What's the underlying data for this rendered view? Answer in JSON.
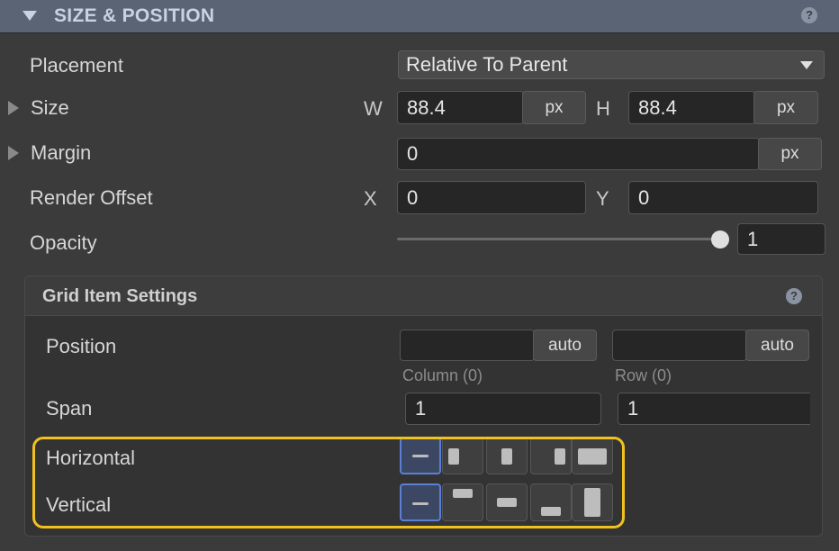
{
  "header": {
    "title": "SIZE & POSITION",
    "help": "?"
  },
  "placement": {
    "label": "Placement",
    "value": "Relative To Parent"
  },
  "size": {
    "label": "Size",
    "w_label": "W",
    "w_value": "88.4",
    "w_unit": "px",
    "h_label": "H",
    "h_value": "88.4",
    "h_unit": "px"
  },
  "margin": {
    "label": "Margin",
    "value": "0",
    "unit": "px"
  },
  "render_offset": {
    "label": "Render Offset",
    "x_label": "X",
    "x_value": "0",
    "y_label": "Y",
    "y_value": "0"
  },
  "opacity": {
    "label": "Opacity",
    "value": "1",
    "level": 1.0
  },
  "grid_item": {
    "title": "Grid Item Settings",
    "help": "?",
    "position": {
      "label": "Position",
      "column_value": "",
      "column_unit": "auto",
      "row_value": "",
      "row_unit": "auto",
      "column_caption": "Column (0)",
      "row_caption": "Row (0)"
    },
    "span": {
      "label": "Span",
      "column_value": "1",
      "row_value": "1"
    },
    "horizontal": {
      "label": "Horizontal",
      "options": [
        "none-icon",
        "align-start-icon",
        "align-center-icon",
        "align-end-icon",
        "stretch-icon"
      ],
      "selected": 0
    },
    "vertical": {
      "label": "Vertical",
      "options": [
        "none-icon",
        "align-top-icon",
        "align-middle-icon",
        "align-bottom-icon",
        "stretch-icon"
      ],
      "selected": 0
    }
  },
  "colors": {
    "header_bg": "#5a6475",
    "accent": "#5b7fd6",
    "highlight": "#f2c21c",
    "panel_bg": "#3b3b3b"
  }
}
